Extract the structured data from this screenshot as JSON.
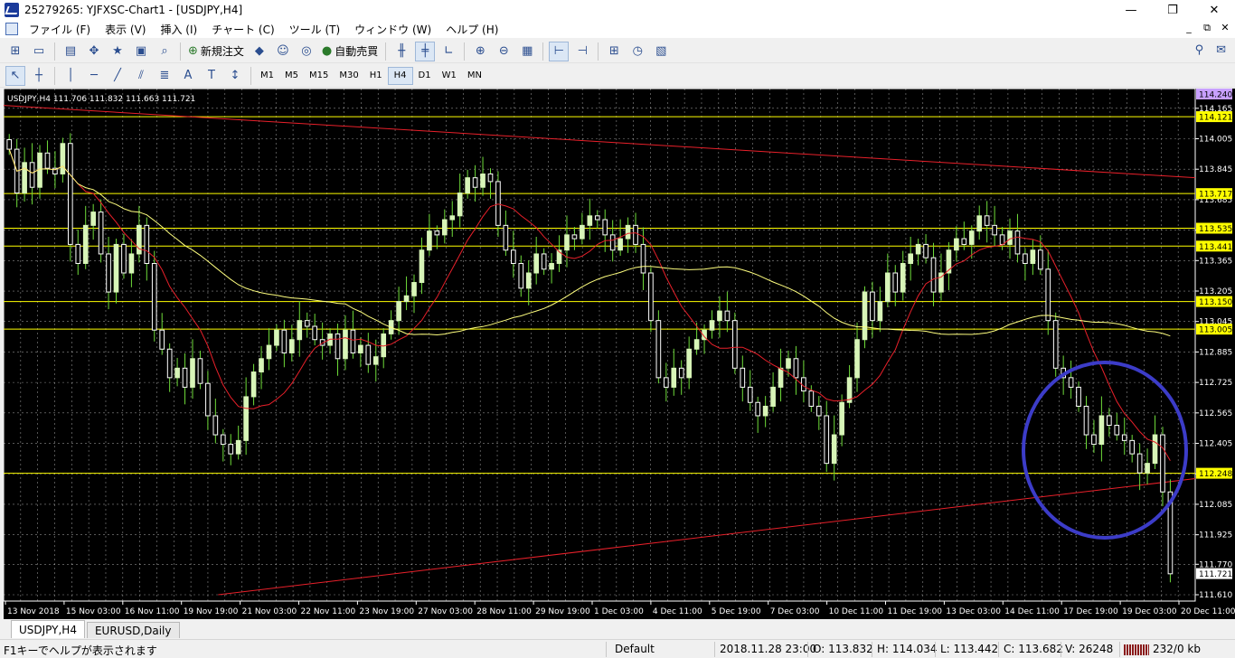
{
  "window": {
    "title": "25279265: YJFXSC-Chart1 - [USDJPY,H4]",
    "controls": [
      "—",
      "❐",
      "✕"
    ]
  },
  "menu": {
    "items": [
      "ファイル (F)",
      "表示 (V)",
      "挿入 (I)",
      "チャート (C)",
      "ツール (T)",
      "ウィンドウ (W)",
      "ヘルプ (H)"
    ],
    "mdi_controls": [
      "_",
      "⧉",
      "✕"
    ]
  },
  "toolbar": {
    "new_order_label": "新規注文",
    "auto_trade_label": "自動売買",
    "timeframes": [
      "M1",
      "M5",
      "M15",
      "M30",
      "H1",
      "H4",
      "D1",
      "W1",
      "MN"
    ],
    "active_timeframe": "H4"
  },
  "chart": {
    "info_label": "USDJPY,H4  111.706 111.832 111.663 111.721",
    "colors": {
      "background": "#000000",
      "grid": "#ffffff",
      "bull_candle": "#d8f5b8",
      "bear_candle": "#ffffff",
      "wick": "#6fdc3a",
      "hline": "#ffff00",
      "trend": "#e8202a",
      "ma_red": "#e8202a",
      "ma_yellow": "#ffff7f",
      "circle": "#3c3cc8",
      "price_tag_yellow": "#ffff00",
      "price_tag_violet": "#c8a0ff"
    }
  },
  "chart_data": {
    "type": "candlestick",
    "symbol": "USDJPY",
    "timeframe": "H4",
    "ohlc_last": {
      "open": 111.706,
      "high": 111.832,
      "low": 111.663,
      "close": 111.721
    },
    "ylim": [
      111.61,
      114.24
    ],
    "y_ticks": [
      "114.165",
      "114.005",
      "113.845",
      "113.685",
      "113.525",
      "113.365",
      "113.205",
      "113.045",
      "112.885",
      "112.725",
      "112.565",
      "112.405",
      "112.245",
      "112.085",
      "111.925",
      "111.770",
      "111.610"
    ],
    "x_ticks": [
      "13 Nov 2018",
      "15 Nov 03:00",
      "16 Nov 11:00",
      "19 Nov 19:00",
      "21 Nov 03:00",
      "22 Nov 11:00",
      "23 Nov 19:00",
      "27 Nov 03:00",
      "28 Nov 11:00",
      "29 Nov 19:00",
      "1 Dec 03:00",
      "4 Dec 11:00",
      "5 Dec 19:00",
      "7 Dec 03:00",
      "10 Dec 11:00",
      "11 Dec 19:00",
      "13 Dec 03:00",
      "14 Dec 11:00",
      "17 Dec 19:00",
      "19 Dec 03:00",
      "20 Dec 11:00"
    ],
    "horizontal_levels": [
      114.121,
      113.717,
      113.535,
      113.441,
      113.15,
      113.005,
      112.248
    ],
    "price_tags": [
      {
        "label": "114.240",
        "value": 114.24,
        "color": "violet"
      },
      {
        "label": "114.121",
        "value": 114.121,
        "color": "yellow"
      },
      {
        "label": "113.717",
        "value": 113.717,
        "color": "yellow"
      },
      {
        "label": "113.535",
        "value": 113.535,
        "color": "yellow"
      },
      {
        "label": "113.441",
        "value": 113.441,
        "color": "yellow"
      },
      {
        "label": "113.150",
        "value": 113.15,
        "color": "yellow"
      },
      {
        "label": "113.005",
        "value": 113.005,
        "color": "yellow"
      },
      {
        "label": "112.248",
        "value": 112.248,
        "color": "yellow"
      },
      {
        "label": "111.721",
        "value": 111.721,
        "color": "white"
      }
    ],
    "closes": [
      113.95,
      113.72,
      113.88,
      113.75,
      113.93,
      113.85,
      113.82,
      113.98,
      113.45,
      113.35,
      113.55,
      113.62,
      113.4,
      113.2,
      113.45,
      113.3,
      113.4,
      113.55,
      113.35,
      113.0,
      112.9,
      112.75,
      112.8,
      112.7,
      112.85,
      112.72,
      112.55,
      112.45,
      112.4,
      112.35,
      112.42,
      112.65,
      112.78,
      112.85,
      112.92,
      113.0,
      112.88,
      112.95,
      113.05,
      113.02,
      112.95,
      112.92,
      112.98,
      112.85,
      113.0,
      112.88,
      112.92,
      112.82,
      112.86,
      112.98,
      113.05,
      113.15,
      113.18,
      113.25,
      113.42,
      113.52,
      113.5,
      113.58,
      113.6,
      113.72,
      113.8,
      113.75,
      113.82,
      113.78,
      113.55,
      113.42,
      113.35,
      113.22,
      113.3,
      113.4,
      113.32,
      113.35,
      113.42,
      113.5,
      113.48,
      113.55,
      113.6,
      113.58,
      113.5,
      113.42,
      113.48,
      113.55,
      113.45,
      113.3,
      113.05,
      112.75,
      112.7,
      112.8,
      112.75,
      112.9,
      112.95,
      113.0,
      113.05,
      113.1,
      113.05,
      112.8,
      112.7,
      112.62,
      112.55,
      112.6,
      112.7,
      112.8,
      112.85,
      112.75,
      112.68,
      112.6,
      112.55,
      112.3,
      112.45,
      112.62,
      112.75,
      112.95,
      113.2,
      113.05,
      113.15,
      113.3,
      113.2,
      113.35,
      113.4,
      113.45,
      113.38,
      113.2,
      113.3,
      113.42,
      113.48,
      113.45,
      113.52,
      113.6,
      113.55,
      113.5,
      113.45,
      113.52,
      113.4,
      113.35,
      113.42,
      113.32,
      113.05,
      112.8,
      112.75,
      112.7,
      112.6,
      112.45,
      112.4,
      112.55,
      112.5,
      112.45,
      112.42,
      112.35,
      112.25,
      112.3,
      112.45,
      112.15,
      111.72
    ],
    "ma_red_range": [
      112.72,
      113.1
    ],
    "ma_yellow_level": 113.15,
    "trendlines": [
      {
        "from": [
          0,
          114.18
        ],
        "to": [
          1,
          113.8
        ]
      },
      {
        "from": [
          0.18,
          111.61
        ],
        "to": [
          1,
          112.22
        ]
      }
    ],
    "annotation": "circle"
  },
  "tabs": [
    {
      "label": "USDJPY,H4",
      "active": true
    },
    {
      "label": "EURUSD,Daily",
      "active": false
    }
  ],
  "status": {
    "help": "F1キーでヘルプが表示されます",
    "profile": "Default",
    "datetime": "2018.11.28 23:00",
    "open": "O: 113.832",
    "high": "H: 114.034",
    "low": "L: 113.442",
    "close": "C: 113.682",
    "volume": "V: 26248",
    "traffic": "232/0 kb"
  }
}
